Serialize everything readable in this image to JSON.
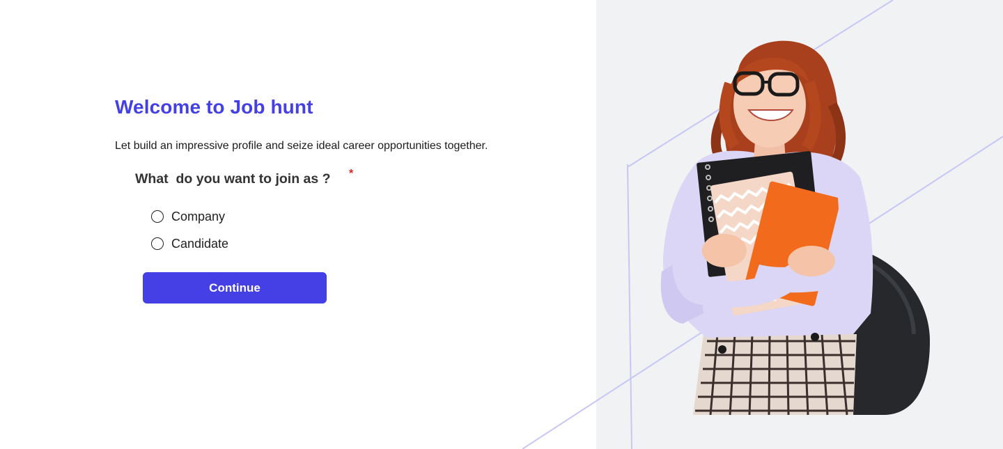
{
  "welcome": {
    "title": "Welcome to Job hunt",
    "subtitle": "Let build an impressive profile and seize ideal career opportunities together."
  },
  "form": {
    "question": "What  do you want to join as ?",
    "required_mark": "*",
    "options": [
      {
        "label": "Company",
        "selected": false
      },
      {
        "label": "Candidate",
        "selected": false
      }
    ],
    "continue_label": "Continue"
  },
  "colors": {
    "accent": "#4540e6",
    "panel_bg": "#f1f2f4",
    "required": "#e0201f"
  },
  "illustration": {
    "icon": "student-holding-notebooks-image"
  }
}
